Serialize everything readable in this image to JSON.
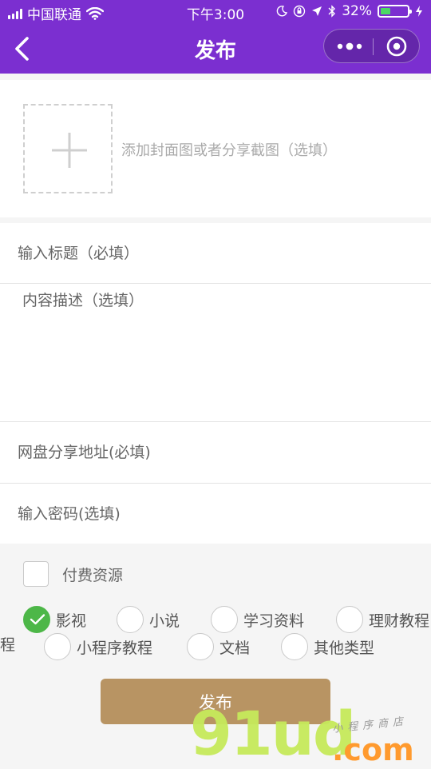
{
  "status_bar": {
    "carrier": "中国联通",
    "time": "下午3:00",
    "battery_percent": "32%",
    "battery_level": 0.32
  },
  "nav": {
    "title": "发布",
    "back_icon": "chevron-left-icon",
    "more_icon": "more-dots-icon",
    "close_icon": "target-circle-icon"
  },
  "cover": {
    "hint": "添加封面图或者分享截图（选填）"
  },
  "form": {
    "title_placeholder": "输入标题（必填）",
    "desc_placeholder": "内容描述（选填）",
    "url_placeholder": "网盘分享地址(必填)",
    "password_placeholder": "输入密码(选填)"
  },
  "options": {
    "paid_label": "付费资源",
    "categories": [
      {
        "label": "影视",
        "selected": true
      },
      {
        "label": "小说",
        "selected": false
      },
      {
        "label": "学习资料",
        "selected": false
      },
      {
        "label": "理财教程",
        "selected": false
      },
      {
        "label": "小程序教程",
        "selected": false
      },
      {
        "label": "文档",
        "selected": false
      },
      {
        "label": "其他类型",
        "selected": false
      }
    ],
    "row_wrap_fragment": "程"
  },
  "publish_label": "发布",
  "watermark": {
    "brand": "91ud",
    "tld": ".com",
    "tagline": "小程序商店"
  },
  "colors": {
    "brand_purple": "#7b2fd0",
    "accent_gold": "#b89463",
    "check_green": "#4db748"
  }
}
